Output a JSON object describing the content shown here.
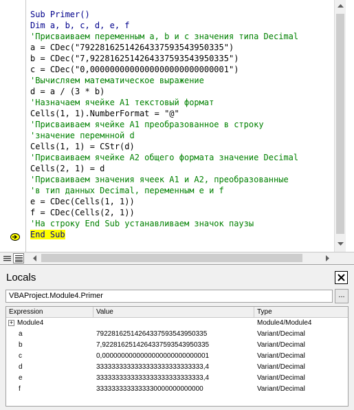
{
  "code": {
    "lines": [
      [
        {
          "t": "Sub Primer()",
          "c": "kw"
        }
      ],
      [
        {
          "t": "Dim a, b, c, d, e, f",
          "c": "kw"
        }
      ],
      [
        {
          "t": "'Присваиваем переменным а, b и с значения типа Decimal",
          "c": "cm"
        }
      ],
      [
        {
          "t": "a = CDec(\"79228162514264337593543950335\")",
          "c": "plain"
        }
      ],
      [
        {
          "t": "b = CDec(\"7,9228162514264337593543950335\")",
          "c": "plain"
        }
      ],
      [
        {
          "t": "c = CDec(\"0,0000000000000000000000000001\")",
          "c": "plain"
        }
      ],
      [
        {
          "t": "'Вычисляем математическое выражение",
          "c": "cm"
        }
      ],
      [
        {
          "t": "d = a / (3 * b)",
          "c": "plain"
        }
      ],
      [
        {
          "t": "'Назначаем ячейке A1 текстовый формат",
          "c": "cm"
        }
      ],
      [
        {
          "t": "Cells(1, 1).NumberFormat = \"@\"",
          "c": "plain"
        }
      ],
      [
        {
          "t": "'Присваиваем ячейке A1 преобразованное в строку",
          "c": "cm"
        }
      ],
      [
        {
          "t": "'значение перемнной d",
          "c": "cm"
        }
      ],
      [
        {
          "t": "Cells(1, 1) = CStr(d)",
          "c": "plain"
        }
      ],
      [
        {
          "t": "'Присваиваем ячейке A2 общего формата значение Decimal",
          "c": "cm"
        }
      ],
      [
        {
          "t": "Cells(2, 1) = d",
          "c": "plain"
        }
      ],
      [
        {
          "t": "'Присваиваем значения ячеек A1 и A2, преобразованные",
          "c": "cm"
        }
      ],
      [
        {
          "t": "'в тип данных Decimal, переменным e и f",
          "c": "cm"
        }
      ],
      [
        {
          "t": "e = CDec(Cells(1, 1))",
          "c": "plain"
        }
      ],
      [
        {
          "t": "f = CDec(Cells(2, 1))",
          "c": "plain"
        }
      ],
      [
        {
          "t": "'На строку End Sub устанавливаем значок паузы",
          "c": "cm"
        }
      ],
      [
        {
          "t": "End Sub",
          "c": "hl"
        }
      ]
    ],
    "highlight_color": "#ffff00",
    "keyword_color": "#00008b",
    "comment_color": "#008000"
  },
  "locals": {
    "title": "Locals",
    "close_label": "✕",
    "context": "VBAProject.Module4.Primer",
    "context_button": "...",
    "columns": [
      "Expression",
      "Value",
      "Type"
    ],
    "rows": [
      {
        "expr": "Module4",
        "value": "",
        "type": "Module4/Module4",
        "expand": "+"
      },
      {
        "expr": "a",
        "value": "79228162514264337593543950335",
        "type": "Variant/Decimal"
      },
      {
        "expr": "b",
        "value": "7,9228162514264337593543950335",
        "type": "Variant/Decimal"
      },
      {
        "expr": "c",
        "value": "0,0000000000000000000000000001",
        "type": "Variant/Decimal"
      },
      {
        "expr": "d",
        "value": "3333333333333333333333333333,4",
        "type": "Variant/Decimal"
      },
      {
        "expr": "e",
        "value": "3333333333333333333333333333,4",
        "type": "Variant/Decimal"
      },
      {
        "expr": "f",
        "value": "3333333333333330000000000000",
        "type": "Variant/Decimal"
      }
    ]
  }
}
